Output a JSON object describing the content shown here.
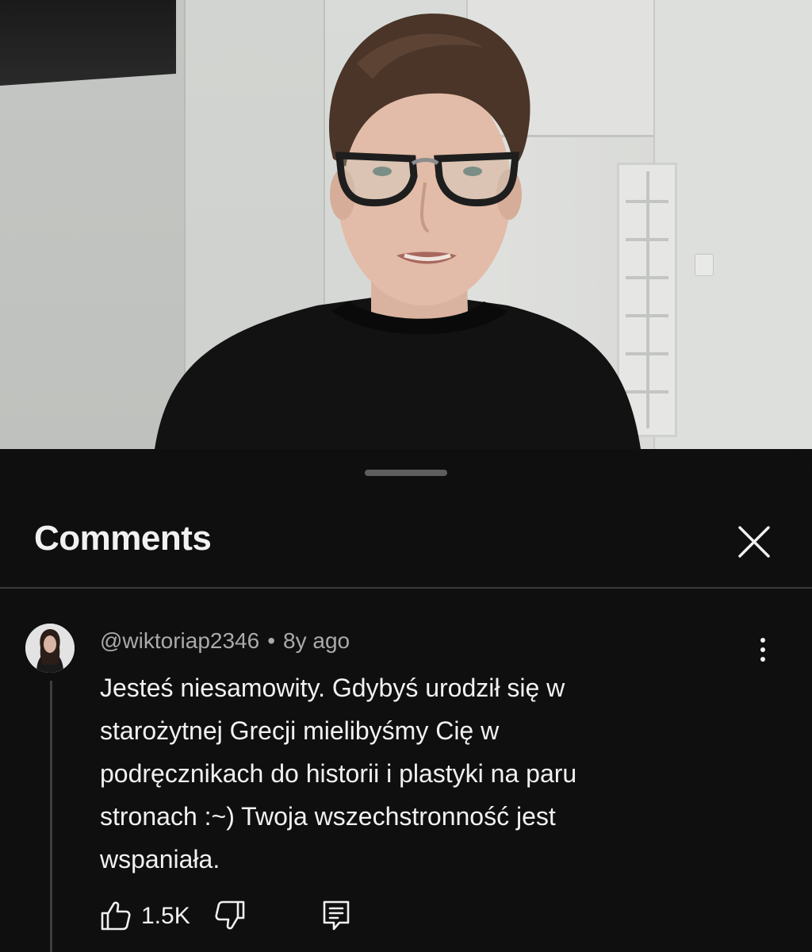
{
  "comments_sheet": {
    "title": "Comments",
    "close_icon": "close-icon"
  },
  "comment": {
    "author": "@wiktoriap2346",
    "separator": "•",
    "age": "8y ago",
    "text_lines": [
      "Jesteś niesamowity. Gdybyś urodził się w",
      "starożytnej Grecji mielibyśmy Cię w",
      "podręcznikach do historii i plastyki na paru",
      "stronach :~) Twoja wszechstronność jest",
      "wspaniała."
    ],
    "like_count": "1.5K",
    "icons": {
      "like": "thumbs-up-icon",
      "dislike": "thumbs-down-icon",
      "reply": "reply-icon",
      "more": "more-vertical-icon"
    }
  },
  "colors": {
    "background": "#0f0f0f",
    "text_primary": "#f1f1f1",
    "text_secondary": "#aaaaaa",
    "divider": "#3a3a3a"
  }
}
